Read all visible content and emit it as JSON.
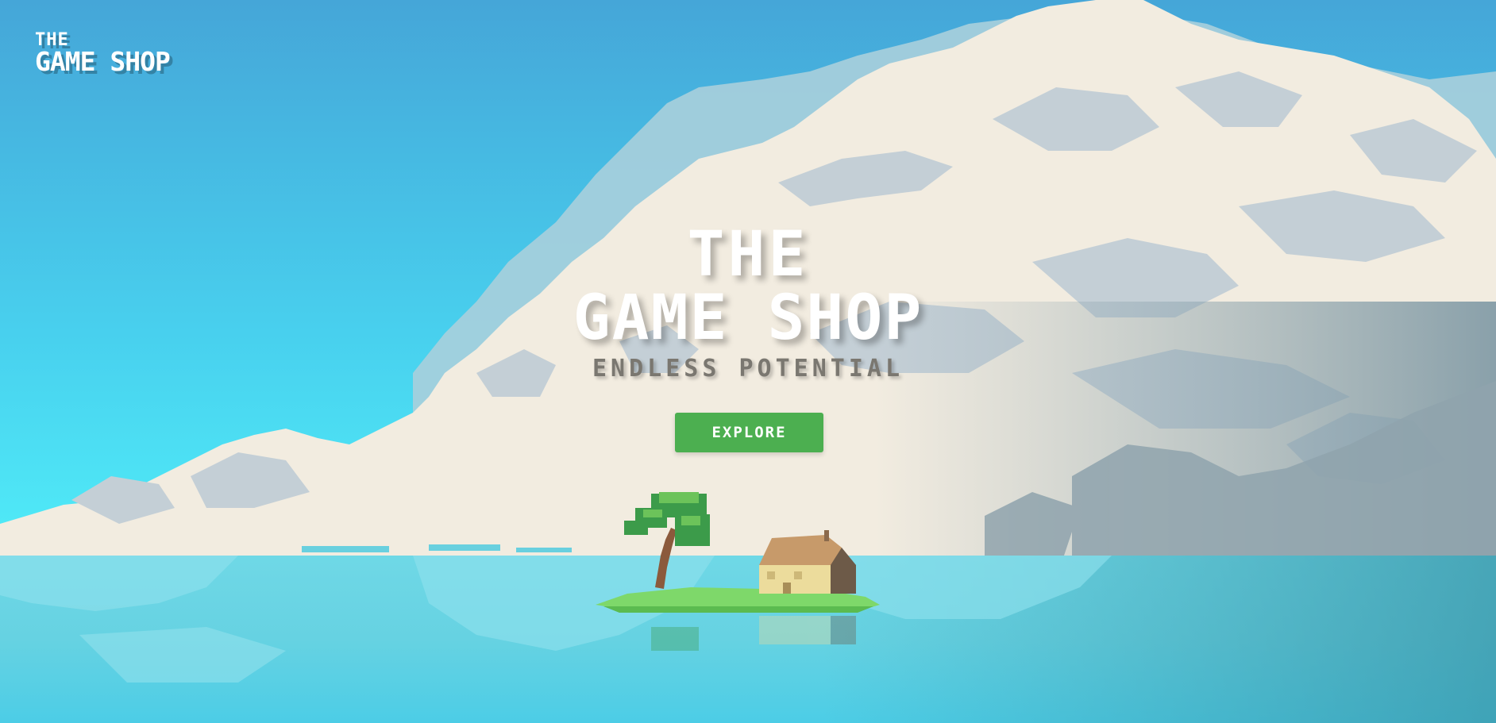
{
  "header": {
    "logo_line1": "THE",
    "logo_line2": "GAME SHOP"
  },
  "hero": {
    "title_line1": "THE",
    "title_line2": "GAME SHOP",
    "subtitle": "ENDLESS POTENTIAL",
    "cta_label": "EXPLORE"
  },
  "colors": {
    "sky_top": "#45a6d8",
    "sky_bottom": "#4fe6f6",
    "cloud_light": "#f2ece0",
    "cloud_shadow": "#c4cfd6",
    "water": "#5ccfe0",
    "cta": "#4caf50"
  },
  "icons": {
    "island": "island-with-tree-and-house"
  }
}
